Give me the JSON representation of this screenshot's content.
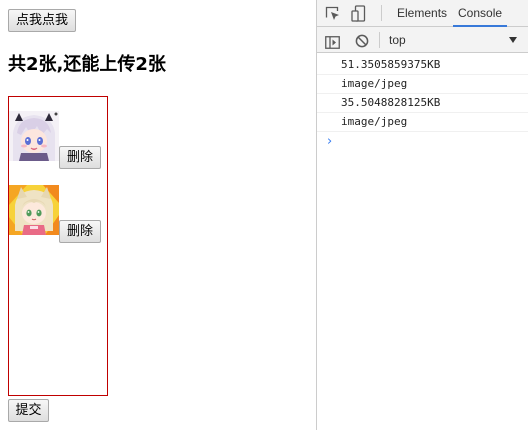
{
  "page": {
    "click_button_label": "点我点我",
    "heading": "共2张,还能上传2张",
    "delete_button_label": "删除",
    "submit_button_label": "提交",
    "images": [
      {
        "name": "thumbnail-image-1"
      },
      {
        "name": "thumbnail-image-2"
      }
    ]
  },
  "devtools": {
    "tabs": {
      "elements": "Elements",
      "console": "Console"
    },
    "active_tab": "Console",
    "context": "top",
    "console_lines": [
      "51.3505859375KB",
      "image/jpeg",
      "35.5048828125KB",
      "image/jpeg"
    ],
    "prompt_symbol": "›",
    "icons": [
      "inspect-icon",
      "device-toolbar-icon",
      "console-sidebar-icon",
      "clear-console-icon",
      "dropdown-arrow-icon",
      "prompt-icon"
    ]
  },
  "colors": {
    "upload_box_border": "#c00000",
    "active_tab_underline": "#3879d9",
    "prompt": "#367cf1"
  }
}
